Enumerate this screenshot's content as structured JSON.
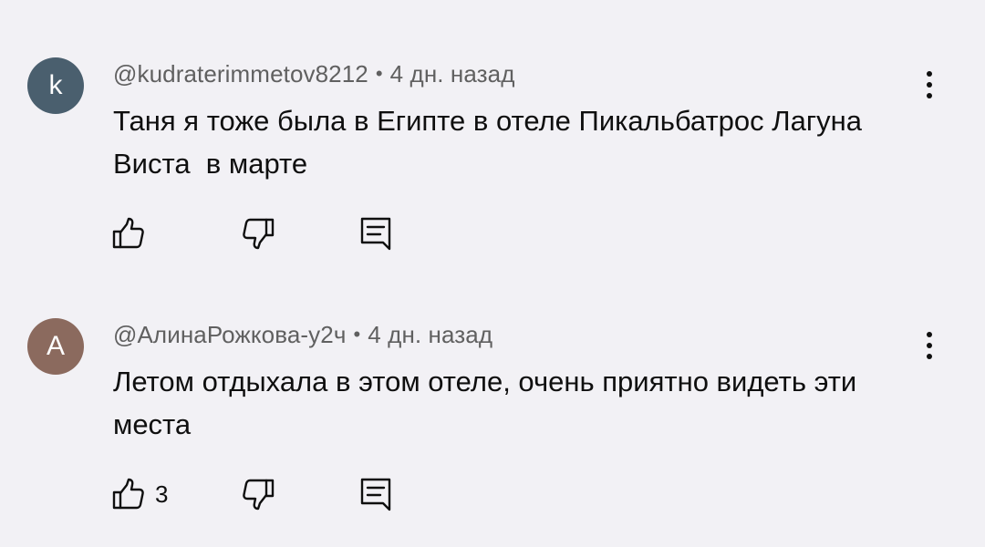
{
  "comments": [
    {
      "avatar_letter": "k",
      "avatar_color": "#4a5f6e",
      "author": "@kudraterimmetov8212",
      "separator": "•",
      "time": "4 дн. назад",
      "text": "Таня я тоже была в Египте в отеле Пикальбатрос Лагуна Виста  в марте",
      "like_count": "",
      "icons": {
        "like": "thumb-up-icon",
        "dislike": "thumb-down-icon",
        "reply": "reply-icon",
        "menu": "more-vert-icon"
      }
    },
    {
      "avatar_letter": "A",
      "avatar_color": "#8b6a5e",
      "author": "@АлинаРожкова-у2ч",
      "separator": "•",
      "time": "4 дн. назад",
      "text": "Летом отдыхала в этом отеле, очень приятно видеть эти места",
      "like_count": "3",
      "icons": {
        "like": "thumb-up-icon",
        "dislike": "thumb-down-icon",
        "reply": "reply-icon",
        "menu": "more-vert-icon"
      }
    }
  ],
  "colors": {
    "background": "#f2f1f5",
    "text": "#0f0f0f",
    "meta": "#606060"
  }
}
